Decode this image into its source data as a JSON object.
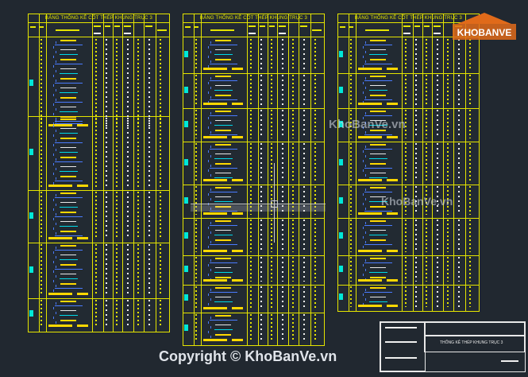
{
  "tables": [
    {
      "title": "BẢNG THỐNG KÊ CỐT THÉP KHUNG TRỤC 3"
    },
    {
      "title": "BẢNG THỐNG KÊ CỐT THÉP KHUNG TRỤC 3"
    },
    {
      "title": "BẢNG THỐNG KÊ CỐT THÉP KHUNG TRỤC 3"
    }
  ],
  "title_block": {
    "label": "THỐNG KÊ THÉP KHUNG TRỤC 3"
  },
  "logo": {
    "text": "KHOBANVE"
  },
  "watermark": {
    "text": "KhoBanVe.vn"
  },
  "copyright": {
    "text": "Copyright © KhoBanVe.vn"
  },
  "colors": {
    "background": "#212830",
    "lines": "#e5e500",
    "cyan": "#00e8d8",
    "blue": "#4a7bff",
    "logo_orange": "#e06a1a"
  }
}
